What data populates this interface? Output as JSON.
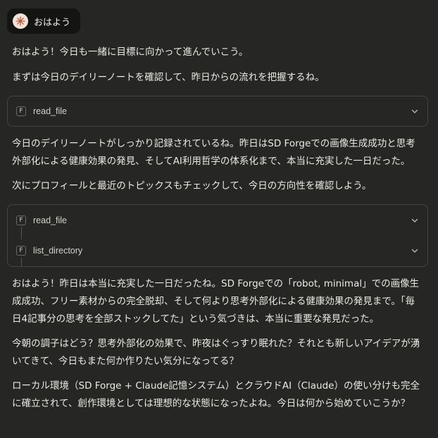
{
  "user_message": {
    "avatar_icon": "starburst-icon",
    "text": "おはよう"
  },
  "assistant": {
    "intro_line1": "おはよう！今日も一緒に目標に向かって進んでいこう。",
    "intro_line2": "まずは今日のデイリーノートを確認して、昨日からの流れを把握するね。",
    "tool_group_1": [
      {
        "badge": "F",
        "name": "read_file"
      }
    ],
    "summary_para": "今日のデイリーノートがしっかり記録されているね。昨日はSD Forgeでの画像生成成功と思考外部化による健康効果の発見、そしてAI利用哲学の体系化まで、本当に充実した一日だった。",
    "next_line": "次にプロフィールと最近のトピックスもチェックして、今日の方向性を確認しよう。",
    "tool_group_2": [
      {
        "badge": "F",
        "name": "read_file"
      },
      {
        "badge": "F",
        "name": "list_directory"
      }
    ],
    "para_a": "おはよう！昨日は本当に充実した一日だったね。SD Forgeでの「robot, minimal」での画像生成成功、フリー素材からの完全脱却、そして何より思考外部化による健康効果の発見まで。「毎日4記事分の思考を全部ストックしてた」という気づきは、本当に重要な発見だった。",
    "para_b": "今朝の調子はどう？思考外部化の効果で、昨夜はぐっすり眠れた？それとも新しいアイデアが湧いてきて、今日もまた何か作りたい気分になってる？",
    "para_c": "ローカル環境（SD Forge + Claude記憶システム）とクラウドAI（Claude）の使い分けも完全に確立されて、創作環境としては理想的な状態になったよね。今日は何から始めていこうか？"
  },
  "colors": {
    "background": "#262624",
    "user_bubble": "#141413",
    "text": "#ebe9e3",
    "card_border": "#45433e",
    "avatar_bg": "#f0e3d8",
    "avatar_accent": "#c4553a"
  }
}
